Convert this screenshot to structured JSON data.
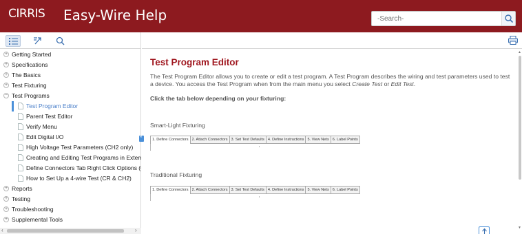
{
  "header": {
    "logo": "CIRRIS",
    "app_title": "Easy-Wire Help",
    "search_placeholder": "-Search-"
  },
  "sidebar": {
    "toolbar": [
      "contents-icon",
      "index-icon",
      "search-icon"
    ],
    "tree": [
      {
        "label": "Getting Started",
        "level": 0,
        "expander": "+"
      },
      {
        "label": "Specifications",
        "level": 0,
        "expander": "+"
      },
      {
        "label": "The Basics",
        "level": 0,
        "expander": "+"
      },
      {
        "label": "Test Fixturing",
        "level": 0,
        "expander": "+"
      },
      {
        "label": "Test Programs",
        "level": 0,
        "expander": "−"
      },
      {
        "label": "Test Program Editor",
        "level": 1,
        "selected": true
      },
      {
        "label": "Parent Test Editor",
        "level": 1
      },
      {
        "label": "Verify Menu",
        "level": 1
      },
      {
        "label": "Edit Digital I/O",
        "level": 1
      },
      {
        "label": "High Voltage Test Parameters (CH2 only)",
        "level": 1
      },
      {
        "label": "Creating and Editing Test Programs in External",
        "level": 1
      },
      {
        "label": "Define Connectors Tab Right Click Options (CH-",
        "level": 1
      },
      {
        "label": "How to Set Up a 4-wire Test (CR & CH2)",
        "level": 1
      },
      {
        "label": "Reports",
        "level": 0,
        "expander": "+"
      },
      {
        "label": "Testing",
        "level": 0,
        "expander": "+"
      },
      {
        "label": "Troubleshooting",
        "level": 0,
        "expander": "+"
      },
      {
        "label": "Supplemental Tools",
        "level": 0,
        "expander": "+"
      }
    ]
  },
  "main": {
    "title": "Test Program Editor",
    "intro_1": "The Test Program Editor allows you to create or edit a test program. A Test Program describes the wiring and test parameters used to test a device. You access the Test Program when from the main menu you select ",
    "intro_create": "Create Test",
    "intro_or": " or ",
    "intro_edit": "Edit Test",
    "intro_end": ".",
    "instruction": "Click the tab below depending on your fixturing:",
    "sections": [
      {
        "label": "Smart-Light Fixturing",
        "tabs": [
          "1.  Define Connectors",
          "2.  Attach Connectors",
          "3.  Set Test Defaults",
          "4.  Define Instructions",
          "5.  View Nets",
          "6.  Label Points"
        ]
      },
      {
        "label": "Traditional Fixturing",
        "tabs": [
          "1.  Define Connectors",
          "2.  Attach Connectors",
          "3.  Set Test Defaults",
          "4.  Define Instructions",
          "5.  View Nets",
          "6.  Label Points"
        ]
      }
    ]
  },
  "colors": {
    "header_bg": "#8d1a1f",
    "title_red": "#a01820",
    "selected_blue": "#4a90d9"
  }
}
